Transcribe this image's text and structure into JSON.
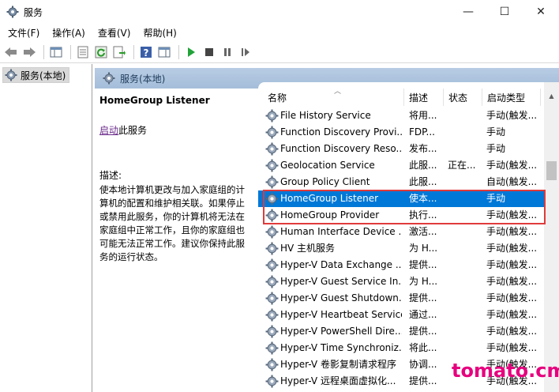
{
  "window": {
    "title": "服务",
    "minimize": "—",
    "maximize": "☐",
    "close": "✕"
  },
  "menubar": {
    "items": [
      "文件(F)",
      "操作(A)",
      "查看(V)",
      "帮助(H)"
    ]
  },
  "toolbar": {
    "icons": [
      "back-arrow-icon",
      "forward-arrow-icon",
      "show-hide-tree-icon",
      "properties-icon",
      "refresh-icon",
      "export-list-icon",
      "help-icon",
      "action-pane-icon",
      "start-service-icon",
      "stop-service-icon",
      "pause-service-icon",
      "restart-service-icon"
    ]
  },
  "tree": {
    "root_label": "服务(本地)"
  },
  "content": {
    "header_label": "服务(本地)",
    "selected_service_name": "HomeGroup Listener",
    "action_link": "启动",
    "action_suffix": "此服务",
    "description_label": "描述:",
    "description_text": "使本地计算机更改与加入家庭组的计算机的配置和维护相关联。如果停止或禁用此服务，你的计算机将无法在家庭组中正常工作，且你的家庭组也可能无法正常工作。建议你保持此服务的运行状态。"
  },
  "table": {
    "columns": {
      "name": "名称",
      "description": "描述",
      "status": "状态",
      "startup_type": "启动类型"
    },
    "rows": [
      {
        "name": "File History Service",
        "description": "将用...",
        "status": "",
        "startup": "手动(触发..."
      },
      {
        "name": "Function Discovery Provi...",
        "description": "FDP...",
        "status": "",
        "startup": "手动"
      },
      {
        "name": "Function Discovery Reso...",
        "description": "发布...",
        "status": "",
        "startup": "手动"
      },
      {
        "name": "Geolocation Service",
        "description": "此服...",
        "status": "正在...",
        "startup": "手动(触发..."
      },
      {
        "name": "Group Policy Client",
        "description": "此服...",
        "status": "",
        "startup": "自动(触发..."
      },
      {
        "name": "HomeGroup Listener",
        "description": "使本...",
        "status": "",
        "startup": "手动"
      },
      {
        "name": "HomeGroup Provider",
        "description": "执行...",
        "status": "",
        "startup": "手动(触发..."
      },
      {
        "name": "Human Interface Device ...",
        "description": "激活...",
        "status": "",
        "startup": "手动(触发..."
      },
      {
        "name": "HV 主机服务",
        "description": "为 H...",
        "status": "",
        "startup": "手动(触发..."
      },
      {
        "name": "Hyper-V Data Exchange ...",
        "description": "提供...",
        "status": "",
        "startup": "手动(触发..."
      },
      {
        "name": "Hyper-V Guest Service In...",
        "description": "为 H...",
        "status": "",
        "startup": "手动(触发..."
      },
      {
        "name": "Hyper-V Guest Shutdown...",
        "description": "提供...",
        "status": "",
        "startup": "手动(触发..."
      },
      {
        "name": "Hyper-V Heartbeat Service",
        "description": "通过...",
        "status": "",
        "startup": "手动(触发..."
      },
      {
        "name": "Hyper-V PowerShell Dire...",
        "description": "提供...",
        "status": "",
        "startup": "手动(触发..."
      },
      {
        "name": "Hyper-V Time Synchroniz...",
        "description": "将此...",
        "status": "",
        "startup": "手动(触发..."
      },
      {
        "name": "Hyper-V 卷影复制请求程序",
        "description": "协调...",
        "status": "",
        "startup": "手动(触发..."
      },
      {
        "name": "Hyper-V 远程桌面虚拟化...",
        "description": "提供...",
        "status": "",
        "startup": "手动(触发..."
      }
    ],
    "selected_index": 5
  },
  "watermark": "tomato.cm",
  "colors": {
    "selection": "#0078d7",
    "highlight_box": "#e03a3a",
    "header_band": "#a4bdd9",
    "watermark": "#e6007e",
    "link": "#6a2a8a"
  }
}
